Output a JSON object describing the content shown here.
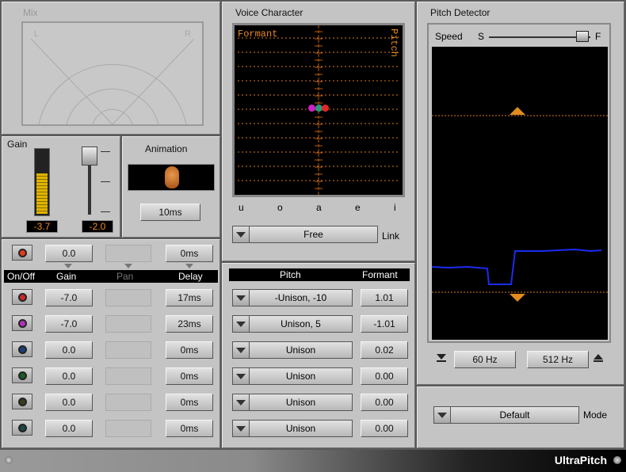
{
  "mix": {
    "title": "Mix",
    "left": "L",
    "right": "R"
  },
  "gain": {
    "title": "Gain",
    "meter_value": "-3.7",
    "fader_value": "-2.0",
    "meter_level": 0.62
  },
  "animation": {
    "title": "Animation",
    "time": "10ms"
  },
  "voice_character": {
    "title": "Voice Character",
    "formant_label": "Formant",
    "pitch_label": "Pitch",
    "vowels": [
      "u",
      "o",
      "a",
      "e",
      "i"
    ],
    "link_mode": "Free",
    "link_label": "Link"
  },
  "pitch_detector": {
    "title": "Pitch Detector",
    "speed_label": "Speed",
    "speed_slow": "S",
    "speed_fast": "F",
    "low_freq": "60 Hz",
    "high_freq": "512 Hz"
  },
  "mode": {
    "value": "Default",
    "label": "Mode"
  },
  "master": {
    "gain": "0.0",
    "delay": "0ms"
  },
  "columns": {
    "onoff": "On/Off",
    "gain": "Gain",
    "pan": "Pan",
    "delay": "Delay",
    "pitch": "Pitch",
    "formant": "Formant"
  },
  "voices": [
    {
      "led": "#c82828",
      "gain": "-7.0",
      "delay": "17ms",
      "pitch": "-Unison, -10",
      "formant": "1.01"
    },
    {
      "led": "#b030c0",
      "gain": "-7.0",
      "delay": "23ms",
      "pitch": "Unison, 5",
      "formant": "-1.01"
    },
    {
      "led": "#1e3c78",
      "gain": "0.0",
      "delay": "0ms",
      "pitch": "Unison",
      "formant": "0.02"
    },
    {
      "led": "#1e5a28",
      "gain": "0.0",
      "delay": "0ms",
      "pitch": "Unison",
      "formant": "0.00"
    },
    {
      "led": "#3c3c1e",
      "gain": "0.0",
      "delay": "0ms",
      "pitch": "Unison",
      "formant": "0.00"
    },
    {
      "led": "#1e4646",
      "gain": "0.0",
      "delay": "0ms",
      "pitch": "Unison",
      "formant": "0.00"
    }
  ],
  "app_name": "UltraPitch"
}
